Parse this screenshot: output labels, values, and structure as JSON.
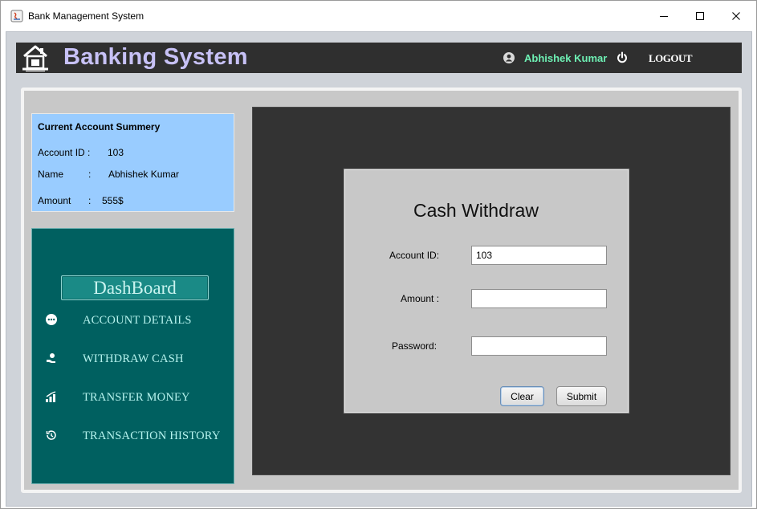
{
  "window": {
    "title": "Bank Management System",
    "controls": {
      "minimize": "–",
      "maximize": "☐",
      "close": "✕"
    }
  },
  "header": {
    "app_title": "Banking System",
    "user_name": "Abhishek Kumar",
    "logout_label": "LOGOUT",
    "icons": [
      "bank-logo-icon",
      "user-icon",
      "power-icon"
    ]
  },
  "summary": {
    "title": "Current Account Summery",
    "account_id_label": "Account ID :",
    "account_id": "103",
    "name_label": "Name",
    "name_sep": ":",
    "name": "Abhishek Kumar",
    "amount_label": "Amount",
    "amount_sep": ":",
    "amount": "555$"
  },
  "nav": {
    "dashboard_label": "DashBoard",
    "items": [
      {
        "label": "ACCOUNT DETAILS",
        "icon": "more-icon"
      },
      {
        "label": "WITHDRAW CASH",
        "icon": "cash-hand-icon"
      },
      {
        "label": "TRANSFER MONEY",
        "icon": "transfer-chart-icon"
      },
      {
        "label": "TRANSACTION HISTORY",
        "icon": "history-icon"
      }
    ]
  },
  "withdraw": {
    "title": "Cash Withdraw",
    "account_id_label": "Account ID:",
    "account_id_value": "103",
    "amount_label": "Amount :",
    "amount_value": "",
    "password_label": "Password:",
    "password_value": "",
    "clear_label": "Clear",
    "submit_label": "Submit"
  },
  "colors": {
    "header_bg": "#2f2f2f",
    "app_title": "#c7c1f6",
    "user_name": "#6ef0b4",
    "summary_bg": "#99ccff",
    "dashboard_bg": "#006060",
    "main_bg": "#333333",
    "dialog_bg": "#c8c8c8"
  }
}
